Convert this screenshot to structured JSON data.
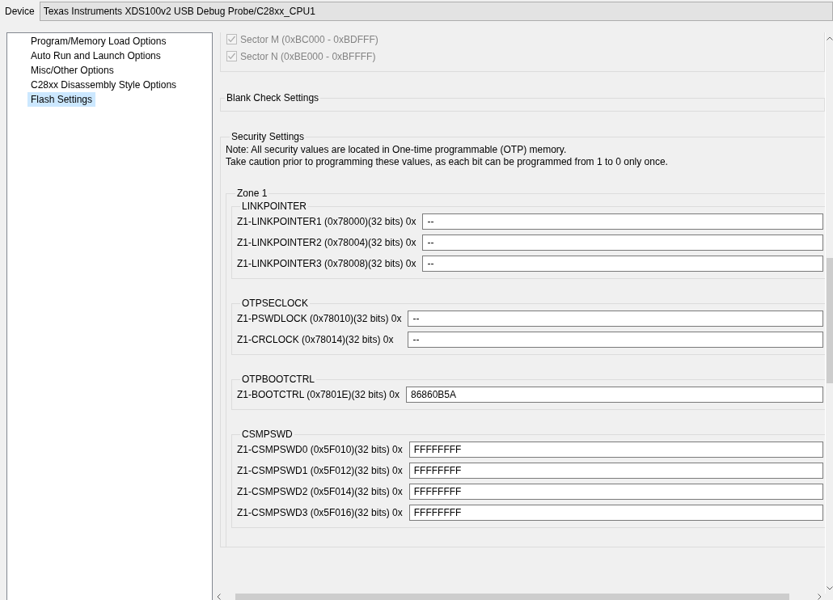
{
  "device": {
    "label": "Device",
    "value": "Texas Instruments XDS100v2 USB Debug Probe/C28xx_CPU1"
  },
  "sidebar": {
    "items": [
      {
        "label": "Program/Memory Load Options",
        "selected": false
      },
      {
        "label": "Auto Run and Launch Options",
        "selected": false
      },
      {
        "label": "Misc/Other Options",
        "selected": false
      },
      {
        "label": "C28xx Disassembly Style Options",
        "selected": false
      },
      {
        "label": "Flash Settings",
        "selected": true
      }
    ]
  },
  "sectors": [
    {
      "label": "Sector M (0xBC000 - 0xBDFFF)",
      "checked": true,
      "disabled": true
    },
    {
      "label": "Sector N (0xBE000 - 0xBFFFF)",
      "checked": true,
      "disabled": true
    }
  ],
  "blank_check": {
    "title": "Blank Check Settings"
  },
  "security": {
    "title": "Security Settings",
    "notes": [
      "Note: All security values are located in One-time programmable (OTP) memory.",
      "Take caution prior to programming these values, as each bit can be programmed from 1 to 0 only once."
    ],
    "zone": {
      "title": "Zone 1",
      "groups": [
        {
          "title": "LINKPOINTER",
          "fields": [
            {
              "label": "Z1-LINKPOINTER1 (0x78000)(32 bits) 0x",
              "value": "--"
            },
            {
              "label": "Z1-LINKPOINTER2 (0x78004)(32 bits) 0x",
              "value": "--"
            },
            {
              "label": "Z1-LINKPOINTER3 (0x78008)(32 bits) 0x",
              "value": "--"
            }
          ]
        },
        {
          "title": "OTPSECLOCK",
          "fields": [
            {
              "label": "Z1-PSWDLOCK (0x78010)(32 bits) 0x",
              "value": "--"
            },
            {
              "label": "Z1-CRCLOCK (0x78014)(32 bits) 0x",
              "value": "--"
            }
          ]
        },
        {
          "title": "OTPBOOTCTRL",
          "fields": [
            {
              "label": "Z1-BOOTCTRL (0x7801E)(32 bits) 0x",
              "value": "86860B5A"
            }
          ]
        },
        {
          "title": "CSMPSWD",
          "fields": [
            {
              "label": "Z1-CSMPSWD0 (0x5F010)(32 bits) 0x",
              "value": "FFFFFFFF"
            },
            {
              "label": "Z1-CSMPSWD1 (0x5F012)(32 bits) 0x",
              "value": "FFFFFFFF"
            },
            {
              "label": "Z1-CSMPSWD2 (0x5F014)(32 bits) 0x",
              "value": "FFFFFFFF"
            },
            {
              "label": "Z1-CSMPSWD3 (0x5F016)(32 bits) 0x",
              "value": "FFFFFFFF"
            }
          ]
        }
      ]
    }
  }
}
